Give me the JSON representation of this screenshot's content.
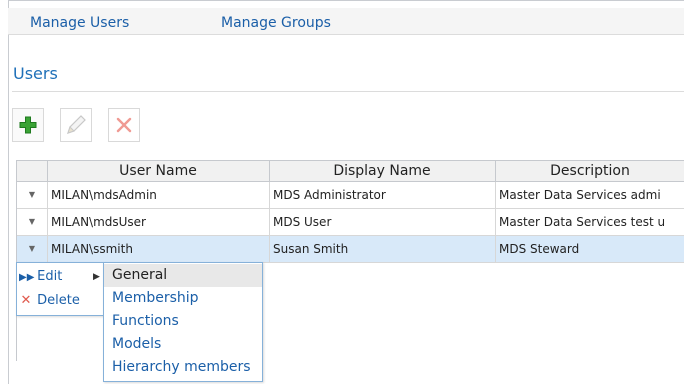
{
  "nav": {
    "manage_users": "Manage Users",
    "manage_groups": "Manage Groups"
  },
  "page": {
    "title": "Users"
  },
  "toolbar": {
    "add_icon": "plus-icon",
    "edit_icon": "pencil-icon",
    "delete_icon": "x-icon"
  },
  "grid": {
    "columns": [
      "User Name",
      "Display Name",
      "Description"
    ],
    "rows": [
      {
        "user_name": "MILAN\\mdsAdmin",
        "display_name": "MDS Administrator",
        "description": "Master Data Services admi"
      },
      {
        "user_name": "MILAN\\mdsUser",
        "display_name": "MDS User",
        "description": "Master Data Services test u"
      },
      {
        "user_name": "MILAN\\ssmith",
        "display_name": "Susan Smith",
        "description": "MDS Steward"
      }
    ]
  },
  "context_menu": {
    "edit": "Edit",
    "delete": "Delete",
    "submenu": [
      "General",
      "Membership",
      "Functions",
      "Models",
      "Hierarchy members"
    ]
  },
  "colors": {
    "link": "#1b5fa8",
    "title": "#1f70b8",
    "selected_row": "#d8e9f9",
    "add_green": "#3aa335",
    "delete_red": "#e05a4e"
  }
}
